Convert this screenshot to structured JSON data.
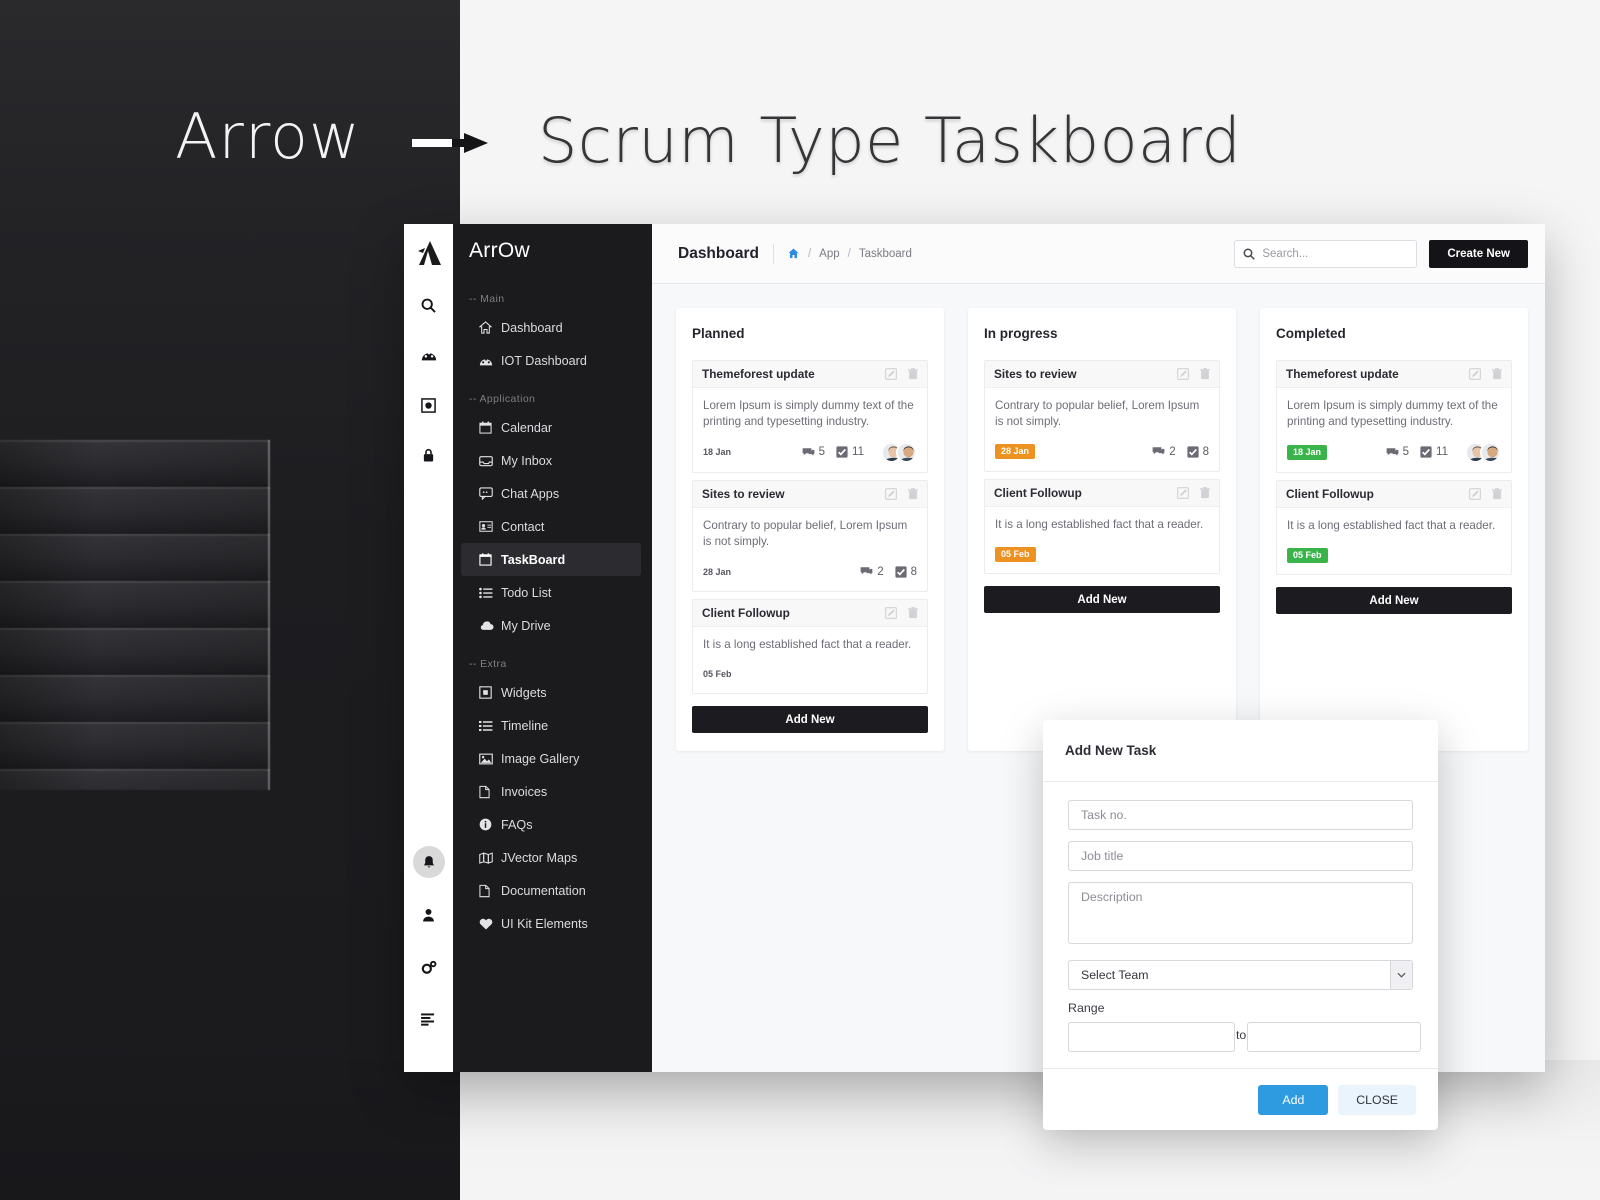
{
  "banner": {
    "brand_word": "Arrow",
    "arrow_glyph": "arrow-right-icon",
    "title": "Scrum Type Taskboard"
  },
  "rail": {
    "logo_icon": "arrow-logo-icon",
    "items": [
      {
        "icon": "search-icon",
        "name": "rail-search"
      },
      {
        "icon": "dashboard-gauge-icon",
        "name": "rail-dashboard"
      },
      {
        "icon": "image-frame-icon",
        "name": "rail-media"
      },
      {
        "icon": "lock-icon",
        "name": "rail-lock"
      }
    ],
    "bottom_items": [
      {
        "icon": "bell-icon",
        "name": "rail-notifications"
      },
      {
        "icon": "user-icon",
        "name": "rail-profile"
      },
      {
        "icon": "gears-icon",
        "name": "rail-settings"
      },
      {
        "icon": "align-left-icon",
        "name": "rail-menu"
      }
    ]
  },
  "sidebar": {
    "brand": "ArrOw",
    "sections": [
      {
        "label": "-- Main",
        "items": [
          {
            "label": "Dashboard",
            "icon": "home-icon",
            "active": false
          },
          {
            "label": "IOT Dashboard",
            "icon": "gauge-icon",
            "active": false
          }
        ]
      },
      {
        "label": "-- Application",
        "items": [
          {
            "label": "Calendar",
            "icon": "calendar-icon",
            "active": false
          },
          {
            "label": "My Inbox",
            "icon": "inbox-icon",
            "active": false
          },
          {
            "label": "Chat Apps",
            "icon": "chat-icon",
            "active": false
          },
          {
            "label": "Contact",
            "icon": "contact-card-icon",
            "active": false
          },
          {
            "label": "TaskBoard",
            "icon": "taskboard-icon",
            "active": true
          },
          {
            "label": "Todo List",
            "icon": "list-icon",
            "active": false
          },
          {
            "label": "My Drive",
            "icon": "cloud-icon",
            "active": false
          }
        ]
      },
      {
        "label": "-- Extra",
        "items": [
          {
            "label": "Widgets",
            "icon": "widget-icon",
            "active": false
          },
          {
            "label": "Timeline",
            "icon": "timeline-icon",
            "active": false
          },
          {
            "label": "Image Gallery",
            "icon": "image-icon",
            "active": false
          },
          {
            "label": "Invoices",
            "icon": "file-icon",
            "active": false
          },
          {
            "label": "FAQs",
            "icon": "info-icon",
            "active": false
          },
          {
            "label": "JVector Maps",
            "icon": "map-icon",
            "active": false
          },
          {
            "label": "Documentation",
            "icon": "file-icon",
            "active": false
          },
          {
            "label": "UI Kit Elements",
            "icon": "heart-icon",
            "active": false
          }
        ]
      }
    ]
  },
  "topbar": {
    "page_title": "Dashboard",
    "breadcrumb": {
      "home_icon": "home-icon",
      "sep1": "/",
      "app": "App",
      "sep2": "/",
      "current": "Taskboard"
    },
    "search": {
      "placeholder": "Search...",
      "value": "",
      "icon": "search-icon"
    },
    "create_button": "Create New"
  },
  "board": {
    "add_new_label": "Add New",
    "columns": [
      {
        "title": "Planned",
        "has_add_new": true,
        "cards": [
          {
            "title": "Themeforest update",
            "desc": "Lorem Ipsum is simply dummy text of the printing and typesetting industry.",
            "date": "18 Jan",
            "date_style": "plain",
            "comments": "5",
            "checks": "11",
            "avatars": 2,
            "edit_icon": "edit-icon",
            "delete_icon": "trash-icon"
          },
          {
            "title": "Sites to review",
            "desc": "Contrary to popular belief, Lorem Ipsum is not simply.",
            "date": "28 Jan",
            "date_style": "plain",
            "comments": "2",
            "checks": "8",
            "avatars": 0,
            "edit_icon": "edit-icon",
            "delete_icon": "trash-icon"
          },
          {
            "title": "Client Followup",
            "desc": "It is a long established fact that a reader.",
            "date": "05 Feb",
            "date_style": "plain",
            "comments": "",
            "checks": "",
            "avatars": 0,
            "edit_icon": "edit-icon",
            "delete_icon": "trash-icon"
          }
        ]
      },
      {
        "title": "In progress",
        "has_add_new": true,
        "cards": [
          {
            "title": "Sites to review",
            "desc": "Contrary to popular belief, Lorem Ipsum is not simply.",
            "date": "28 Jan",
            "date_style": "orange",
            "comments": "2",
            "checks": "8",
            "avatars": 0,
            "edit_icon": "edit-icon",
            "delete_icon": "trash-icon"
          },
          {
            "title": "Client Followup",
            "desc": "It is a long established fact that a reader.",
            "date": "05 Feb",
            "date_style": "orange",
            "comments": "",
            "checks": "",
            "avatars": 0,
            "edit_icon": "edit-icon",
            "delete_icon": "trash-icon"
          }
        ]
      },
      {
        "title": "Completed",
        "has_add_new": true,
        "cards": [
          {
            "title": "Themeforest update",
            "desc": "Lorem Ipsum is simply dummy text of the printing and typesetting industry.",
            "date": "18 Jan",
            "date_style": "green",
            "comments": "5",
            "checks": "11",
            "avatars": 2,
            "edit_icon": "edit-icon",
            "delete_icon": "trash-icon"
          },
          {
            "title": "Client Followup",
            "desc": "It is a long established fact that a reader.",
            "date": "05 Feb",
            "date_style": "green",
            "comments": "",
            "checks": "",
            "avatars": 0,
            "edit_icon": "edit-icon",
            "delete_icon": "trash-icon"
          }
        ]
      }
    ]
  },
  "modal": {
    "title": "Add New Task",
    "task_no_placeholder": "Task no.",
    "task_no_value": "",
    "job_title_placeholder": "Job title",
    "job_title_value": "",
    "description_placeholder": "Description",
    "description_value": "",
    "select_team_value": "Select Team",
    "select_team_options": [
      "Select Team"
    ],
    "range_label": "Range",
    "range_from_value": "",
    "range_to_text": "to",
    "range_to_value": "",
    "add_label": "Add",
    "close_label": "CLOSE"
  },
  "colors": {
    "accent_blue": "#2e9ae0",
    "badge_orange": "#ed9121",
    "badge_green": "#3ab44a",
    "sidebar_dark": "#1b1b1e",
    "button_dark": "#1c1c20"
  }
}
